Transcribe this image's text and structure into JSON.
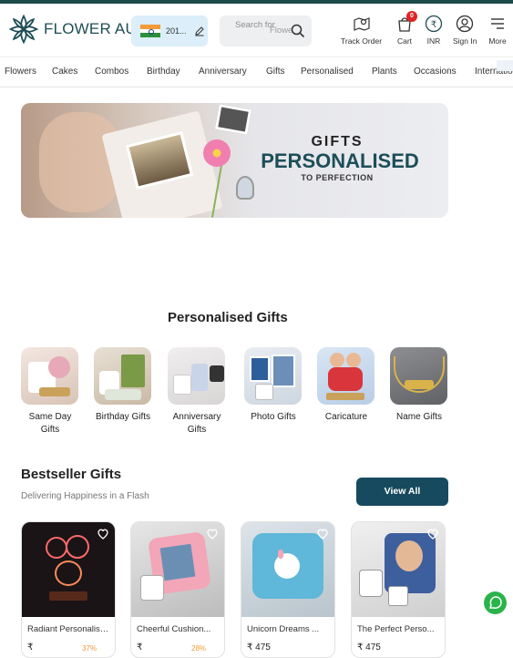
{
  "header": {
    "logo_text": "FLOWER AURA",
    "country_code": "201...",
    "search": {
      "placeholder_line1": "Search for",
      "placeholder_line2": "Flowe"
    },
    "actions": [
      {
        "label": "Track Order",
        "icon": "map-pin-icon"
      },
      {
        "label": "Cart",
        "icon": "cart-icon",
        "badge": "0"
      },
      {
        "label": "INR",
        "icon": "rupee-icon"
      },
      {
        "label": "Sign In",
        "icon": "user-icon"
      },
      {
        "label": "More",
        "icon": "menu-icon"
      }
    ]
  },
  "nav": {
    "items": [
      "Flowers",
      "Cakes",
      "Combos",
      "Birthday",
      "Anniversary",
      "Gifts",
      "Personalised",
      "Plants",
      "Occasions",
      "International"
    ]
  },
  "banner": {
    "line1": "GIFTS",
    "line2": "PERSONALISED",
    "line3": "TO PERFECTION"
  },
  "personalised": {
    "title": "Personalised Gifts",
    "categories": [
      {
        "name": "Same Day Gifts"
      },
      {
        "name": "Birthday Gifts"
      },
      {
        "name": "Anniversary Gifts"
      },
      {
        "name": "Photo Gifts"
      },
      {
        "name": "Caricature"
      },
      {
        "name": "Name Gifts"
      }
    ]
  },
  "bestseller": {
    "title": "Bestseller Gifts",
    "subtitle": "Delivering Happiness in a Flash",
    "view_all": "View All",
    "products": [
      {
        "name": "Radiant Personalised...",
        "price": "₹",
        "discount": "37%"
      },
      {
        "name": "Cheerful Cushion...",
        "price": "₹",
        "discount": "28%"
      },
      {
        "name": "Unicorn Dreams ...",
        "price": "₹ 475",
        "discount": ""
      },
      {
        "name": "The Perfect Perso...",
        "price": "₹ 475",
        "discount": ""
      }
    ]
  },
  "colors": {
    "brand": "#1c4e59",
    "accent": "#174a5e",
    "badge": "#e02424"
  }
}
